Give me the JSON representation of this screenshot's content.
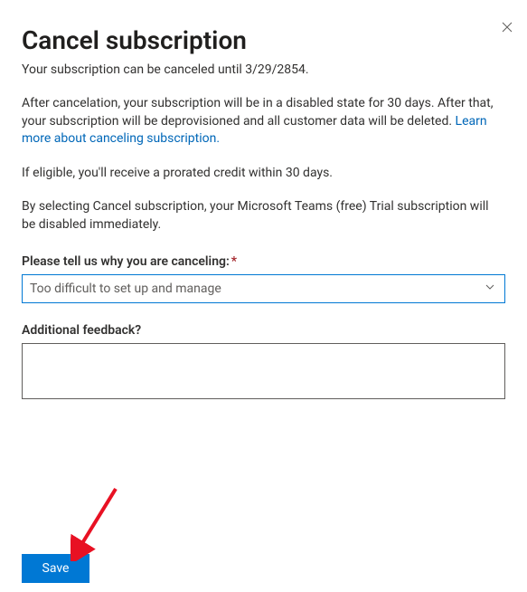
{
  "dialog": {
    "title": "Cancel subscription",
    "subtitle": "Your subscription can be canceled until 3/29/2854.",
    "para1_before_link": "After cancelation, your subscription will be in a disabled state for 30 days. After that, your subscription will be deprovisioned and all customer data will be deleted. ",
    "link_text": "Learn more about canceling subscription.",
    "para2": "If eligible, you'll receive a prorated credit within 30 days.",
    "para3": "By selecting Cancel subscription, your Microsoft Teams (free) Trial subscription will be disabled immediately.",
    "reason_label": "Please tell us why you are canceling:",
    "reason_selected": "Too difficult to set up and manage",
    "feedback_label": "Additional feedback?",
    "feedback_value": "",
    "save_button": "Save"
  }
}
